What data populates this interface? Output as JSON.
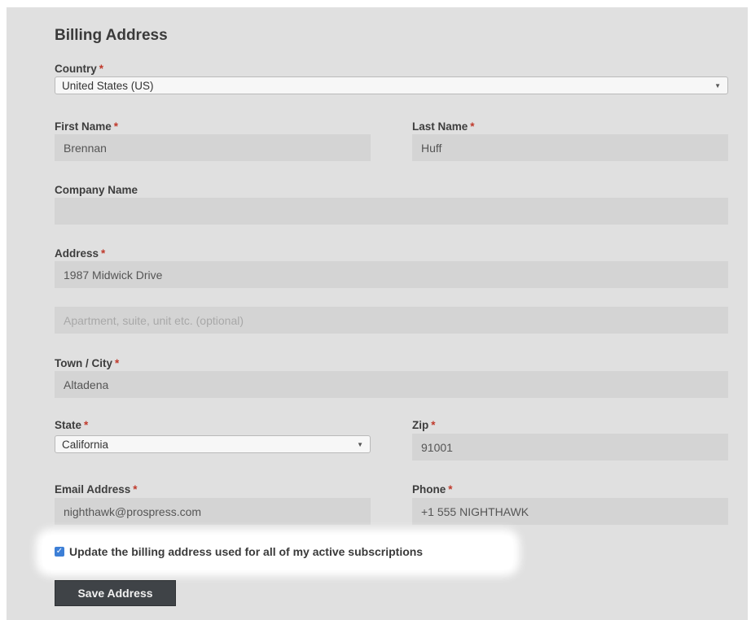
{
  "form": {
    "title": "Billing Address",
    "required_mark": "*",
    "country": {
      "label": "Country",
      "value": "United States (US)"
    },
    "first_name": {
      "label": "First Name",
      "value": "Brennan"
    },
    "last_name": {
      "label": "Last Name",
      "value": "Huff"
    },
    "company": {
      "label": "Company Name",
      "value": ""
    },
    "address": {
      "label": "Address",
      "value": "1987 Midwick Drive",
      "line2_placeholder": "Apartment, suite, unit etc. (optional)"
    },
    "city": {
      "label": "Town / City",
      "value": "Altadena"
    },
    "state": {
      "label": "State",
      "value": "California"
    },
    "zip": {
      "label": "Zip",
      "value": "91001"
    },
    "email": {
      "label": "Email Address",
      "value": "nighthawk@prospress.com"
    },
    "phone": {
      "label": "Phone",
      "value": "+1 555 NIGHTHAWK"
    },
    "update_subscriptions": {
      "label": "Update the billing address used for all of my active subscriptions",
      "checked": true
    },
    "save_label": "Save Address"
  },
  "icons": {
    "select_caret": "chevron-down-icon",
    "checkbox": "checkmark-icon"
  },
  "colors": {
    "required": "#c0392b",
    "checkbox": "#3d7fd6",
    "button_bg": "#3f4347"
  }
}
